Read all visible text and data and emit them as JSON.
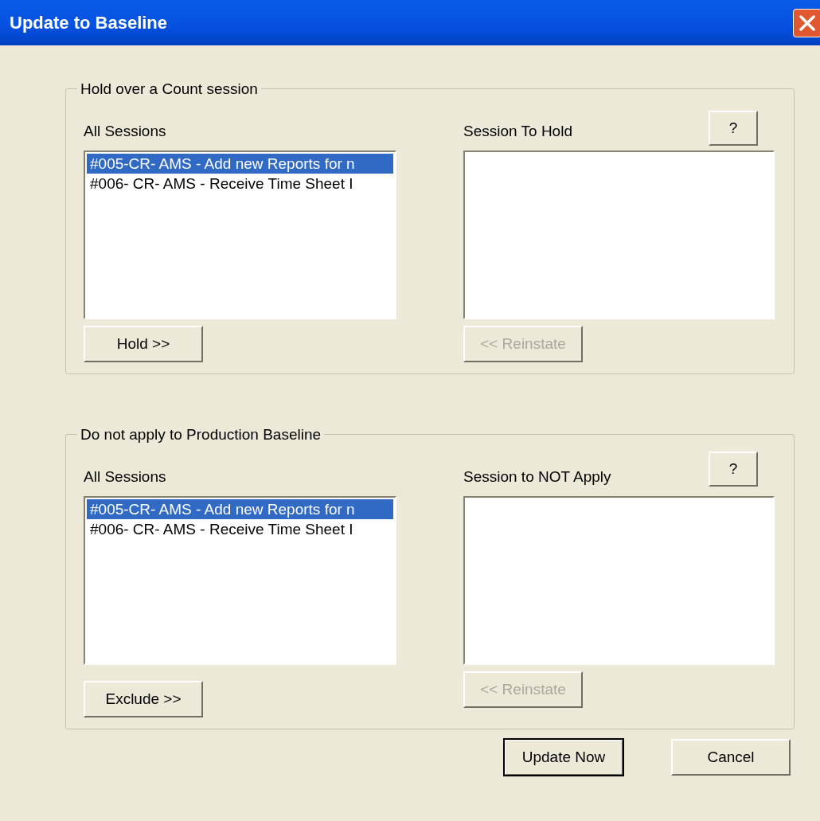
{
  "window": {
    "title": "Update to Baseline"
  },
  "groups": [
    {
      "title": "Hold over a Count session",
      "help_button": "?",
      "source": {
        "label": "All Sessions",
        "items": [
          {
            "text": "#005-CR- AMS - Add new Reports for n",
            "selected": true
          },
          {
            "text": "#006- CR- AMS - Receive Time Sheet I",
            "selected": false
          }
        ]
      },
      "move_button": {
        "label": "Hold >>",
        "disabled": false
      },
      "target": {
        "label": "Session To Hold"
      },
      "return_button": {
        "label": "<< Reinstate",
        "disabled": true
      }
    },
    {
      "title": "Do not apply to Production Baseline",
      "help_button": "?",
      "source": {
        "label": "All Sessions",
        "items": [
          {
            "text": "#005-CR- AMS - Add new Reports for n",
            "selected": true
          },
          {
            "text": "#006- CR- AMS - Receive Time Sheet I",
            "selected": false
          }
        ]
      },
      "move_button": {
        "label": "Exclude >>",
        "disabled": false
      },
      "target": {
        "label": "Session to NOT Apply"
      },
      "return_button": {
        "label": "<< Reinstate",
        "disabled": true
      }
    }
  ],
  "buttons": [
    {
      "label": "Update Now",
      "default": true
    },
    {
      "label": "Cancel",
      "default": false
    }
  ]
}
